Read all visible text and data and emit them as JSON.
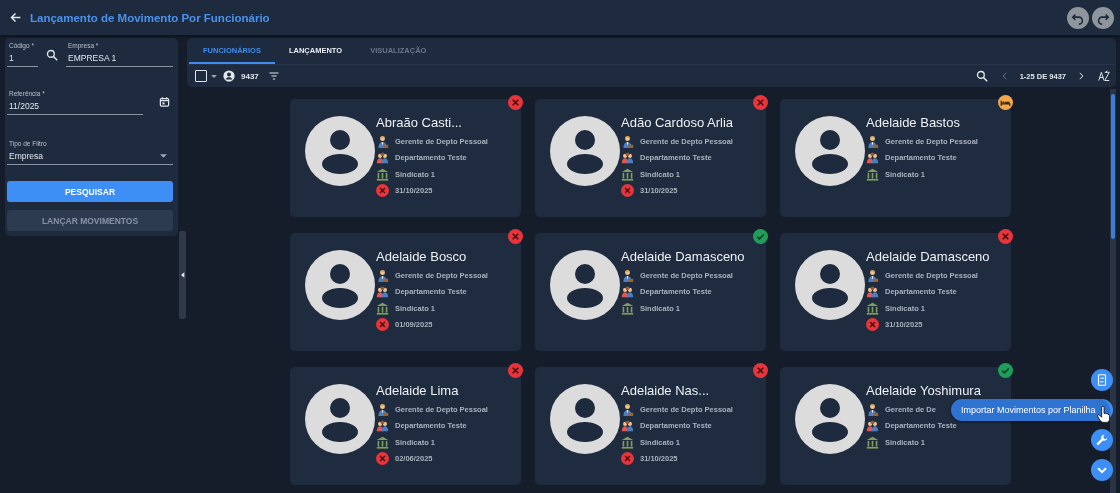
{
  "header": {
    "title": "Lançamento de Movimento Por Funcionário"
  },
  "form": {
    "fields": [
      {
        "kind": "text",
        "label": "Código *",
        "value": "1"
      },
      {
        "kind": "text",
        "label": "Empresa *",
        "value": "EMPRESA 1"
      },
      {
        "kind": "date",
        "label": "Referência *",
        "value": "11/2025"
      },
      {
        "kind": "select",
        "label": "Tipo de Filtro",
        "value": "Empresa"
      }
    ],
    "buttons": [
      {
        "label": "PESQUISAR",
        "disabled": false
      },
      {
        "label": "LANÇAR MOVIMENTOS",
        "disabled": true
      }
    ]
  },
  "tabs": [
    {
      "label": "FUNCIONÁRIOS",
      "selected": true,
      "disabled": false
    },
    {
      "label": "LANÇAMENTO",
      "selected": false,
      "disabled": false
    },
    {
      "label": "VISUALIZAÇÃO",
      "selected": false,
      "disabled": true
    }
  ],
  "toolbar": {
    "checked": false,
    "count": "9437",
    "pagination": "1-25 DE 9437"
  },
  "employees": [
    {
      "name": "Abraão Casti...",
      "role": "Gerente de Depto Pessoal",
      "department": "Departamento Teste",
      "union": "Sindicato 1",
      "badge": {
        "kind": "error"
      },
      "date": "31/10/2025"
    },
    {
      "name": "Adão Cardoso Arlia",
      "role": "Gerente de Depto Pessoal",
      "department": "Departamento Teste",
      "union": "Sindicato 1",
      "badge": {
        "kind": "error"
      },
      "date": "31/10/2025"
    },
    {
      "name": "Adelaide Bastos",
      "role": "Gerente de Depto Pessoal",
      "department": "Departamento Teste",
      "union": "Sindicato 1",
      "badge": {
        "kind": "leave"
      }
    },
    {
      "name": "Adelaide Bosco",
      "role": "Gerente de Depto Pessoal",
      "department": "Departamento Teste",
      "union": "Sindicato 1",
      "badge": {
        "kind": "error"
      },
      "date": "01/09/2025"
    },
    {
      "name": "Adelaide Damasceno",
      "role": "Gerente de Depto Pessoal",
      "department": "Departamento Teste",
      "union": "Sindicato 1",
      "badge": {
        "kind": "ok"
      }
    },
    {
      "name": "Adelaide Damasceno",
      "role": "Gerente de Depto Pessoal",
      "department": "Departamento Teste",
      "union": "Sindicato 1",
      "badge": {
        "kind": "error"
      },
      "date": "31/10/2025"
    },
    {
      "name": "Adelaide Lima",
      "role": "Gerente de Depto Pessoal",
      "department": "Departamento Teste",
      "union": "Sindicato 1",
      "badge": {
        "kind": "error"
      },
      "date": "02/06/2025"
    },
    {
      "name": "Adelaide Nas...",
      "role": "Gerente de Depto Pessoal",
      "department": "Departamento Teste",
      "union": "Sindicato 1",
      "badge": {
        "kind": "error"
      },
      "date": "31/10/2025"
    },
    {
      "name": "Adelaide Yoshimura",
      "role": "Gerente de De",
      "department": "Departamento Teste",
      "union": "Sindicato 1",
      "badge": {
        "kind": "ok"
      }
    }
  ],
  "fab": {
    "tooltip": "Importar Movimentos por Planilha"
  }
}
